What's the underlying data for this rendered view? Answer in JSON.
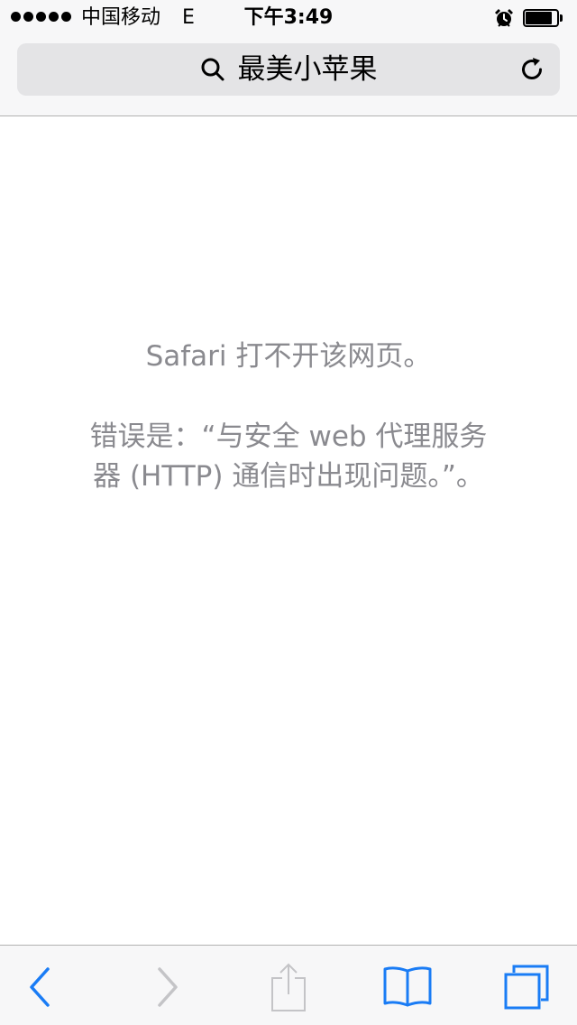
{
  "status_bar": {
    "signal_bars": 5,
    "carrier": "中国移动",
    "network": "E",
    "time": "下午3:49",
    "alarm_icon": "alarm-clock-icon",
    "battery_level": 0.85
  },
  "address_bar": {
    "search_icon": "search-icon",
    "text": "最美小苹果",
    "reload_icon": "reload-icon"
  },
  "error_page": {
    "title": "Safari 打不开该网页。",
    "message": "错误是：“与安全 web 代理服务器 (HTTP) 通信时出现问题。”。"
  },
  "toolbar": {
    "back": {
      "icon": "chevron-left-icon",
      "enabled": true
    },
    "forward": {
      "icon": "chevron-right-icon",
      "enabled": false
    },
    "share": {
      "icon": "share-icon",
      "enabled": false
    },
    "bookmarks": {
      "icon": "book-icon",
      "enabled": true
    },
    "tabs": {
      "icon": "tabs-icon",
      "enabled": true
    }
  },
  "colors": {
    "accent": "#1a7cf5",
    "disabled": "#c4c4c7",
    "error_text": "#8a8a8f",
    "bar_background": "#f7f7f8",
    "address_field": "#e4e4e6"
  }
}
